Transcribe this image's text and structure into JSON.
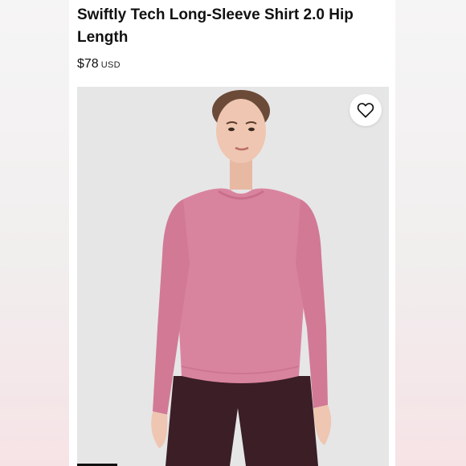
{
  "product": {
    "title": "Swiftly Tech Long-Sleeve Shirt 2.0 Hip Length",
    "price": "$78",
    "currency": "USD"
  },
  "image": {
    "subject": "model wearing pink long-sleeve shirt and dark burgundy leggings",
    "shirt_color": "#d9849f",
    "leggings_color": "#3b1e26",
    "background_color": "#e6e6e7"
  },
  "icons": {
    "wishlist": "heart-icon"
  }
}
